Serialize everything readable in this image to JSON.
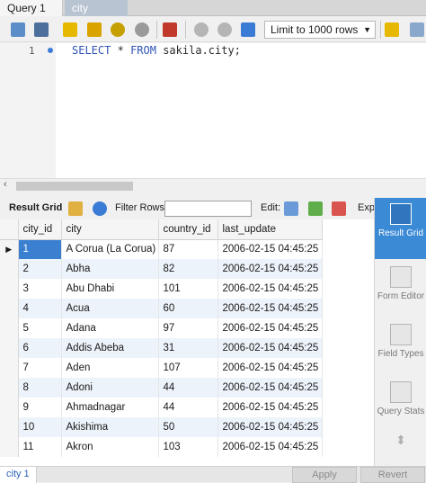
{
  "tabs": [
    {
      "label": "Query 1"
    },
    {
      "label": "city"
    }
  ],
  "toolbar": {
    "limit_label": "Limit to 1000 rows"
  },
  "editor": {
    "line_number": "1",
    "sql_keyword1": "SELECT",
    "sql_star": "*",
    "sql_keyword2": "FROM",
    "sql_rest": "sakila.city;"
  },
  "results_toolbar": {
    "result_grid": "Result Grid",
    "filter_rows": "Filter Rows:",
    "filter_value": "",
    "edit": "Edit:",
    "export": "Expo"
  },
  "grid": {
    "columns": [
      "city_id",
      "city",
      "country_id",
      "last_update"
    ],
    "rows": [
      [
        "1",
        "A Corua (La Corua)",
        "87",
        "2006-02-15 04:45:25"
      ],
      [
        "2",
        "Abha",
        "82",
        "2006-02-15 04:45:25"
      ],
      [
        "3",
        "Abu Dhabi",
        "101",
        "2006-02-15 04:45:25"
      ],
      [
        "4",
        "Acua",
        "60",
        "2006-02-15 04:45:25"
      ],
      [
        "5",
        "Adana",
        "97",
        "2006-02-15 04:45:25"
      ],
      [
        "6",
        "Addis Abeba",
        "31",
        "2006-02-15 04:45:25"
      ],
      [
        "7",
        "Aden",
        "107",
        "2006-02-15 04:45:25"
      ],
      [
        "8",
        "Adoni",
        "44",
        "2006-02-15 04:45:25"
      ],
      [
        "9",
        "Ahmadnagar",
        "44",
        "2006-02-15 04:45:25"
      ],
      [
        "10",
        "Akishima",
        "50",
        "2006-02-15 04:45:25"
      ],
      [
        "11",
        "Akron",
        "103",
        "2006-02-15 04:45:25"
      ]
    ]
  },
  "side_panel": {
    "result_grid": "Result Grid",
    "form_editor": "Form Editor",
    "field_types": "Field Types",
    "query_stats": "Query Stats"
  },
  "bottom": {
    "tab": "city 1",
    "apply": "Apply",
    "revert": "Revert"
  },
  "colors": {
    "accent": "#3a8ad6",
    "selected_cell": "#3b7fd0",
    "alt_row": "#edf3fb"
  }
}
